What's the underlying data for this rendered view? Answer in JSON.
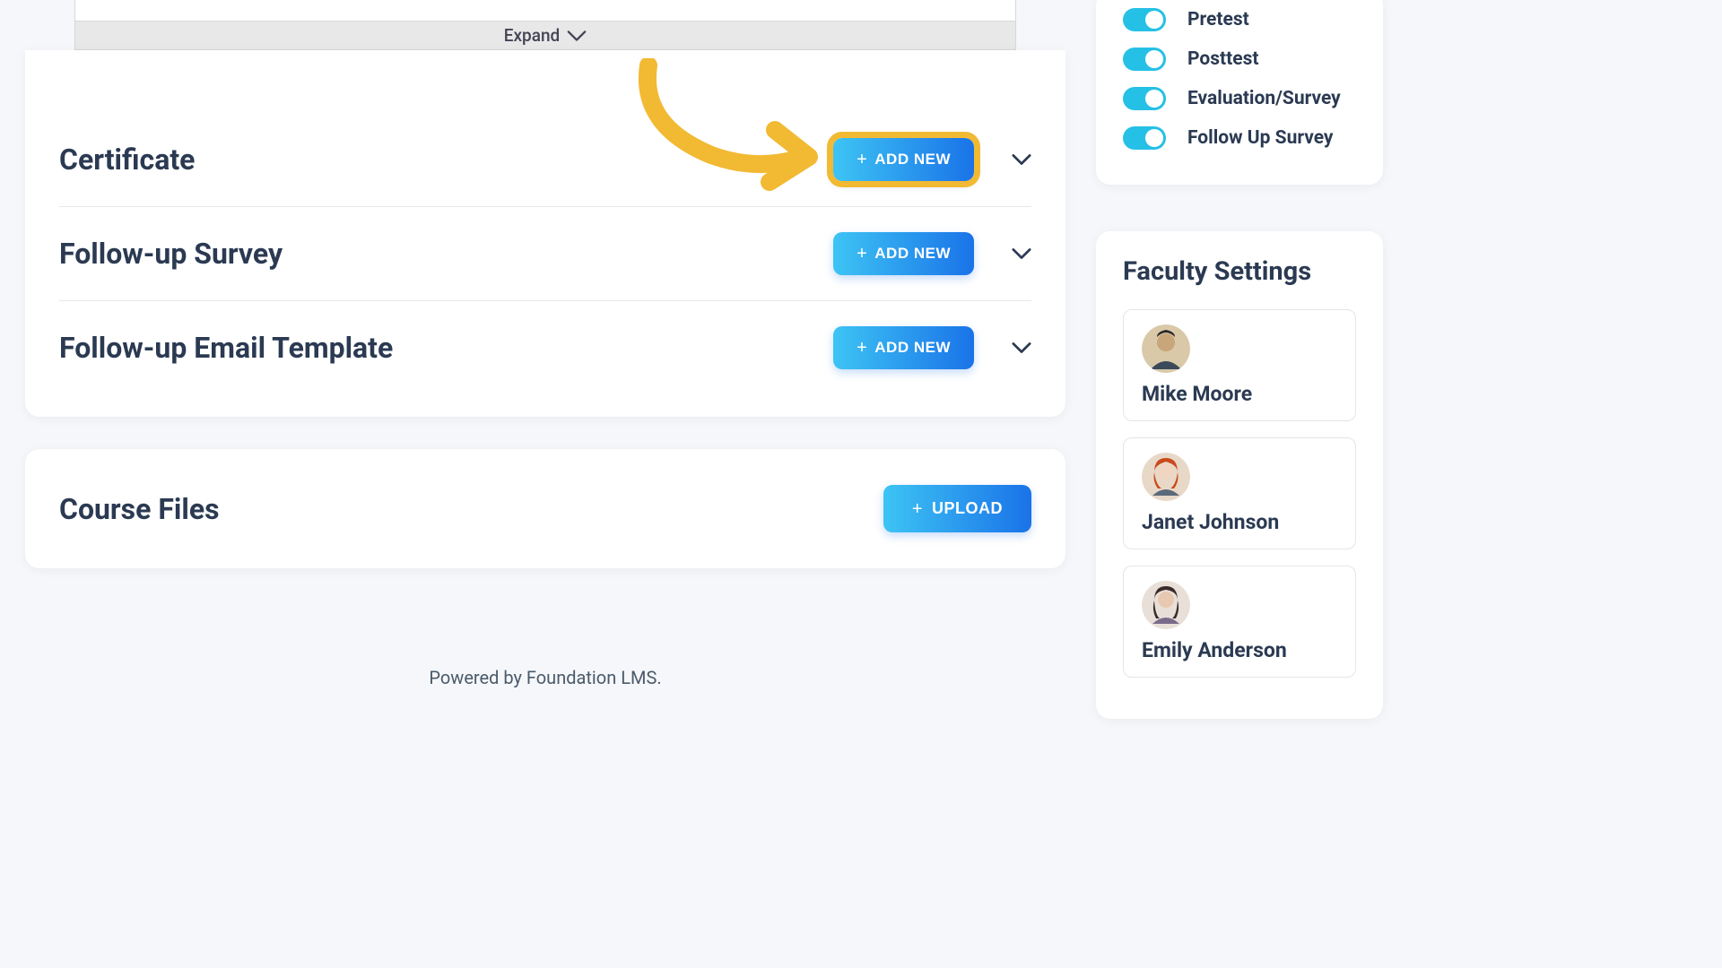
{
  "expand": {
    "label": "Expand"
  },
  "sections": [
    {
      "title": "Certificate",
      "button_label": "ADD NEW"
    },
    {
      "title": "Follow-up Survey",
      "button_label": "ADD NEW"
    },
    {
      "title": "Follow-up Email Template",
      "button_label": "ADD NEW"
    }
  ],
  "course_files": {
    "title": "Course Files",
    "button_label": "UPLOAD"
  },
  "footer": {
    "text": "Powered by Foundation LMS."
  },
  "toggles": [
    {
      "label": "Pretest"
    },
    {
      "label": "Posttest"
    },
    {
      "label": "Evaluation/Survey"
    },
    {
      "label": "Follow Up Survey"
    }
  ],
  "faculty": {
    "heading": "Faculty Settings",
    "members": [
      {
        "name": "Mike Moore"
      },
      {
        "name": "Janet Johnson"
      },
      {
        "name": "Emily Anderson"
      }
    ]
  }
}
